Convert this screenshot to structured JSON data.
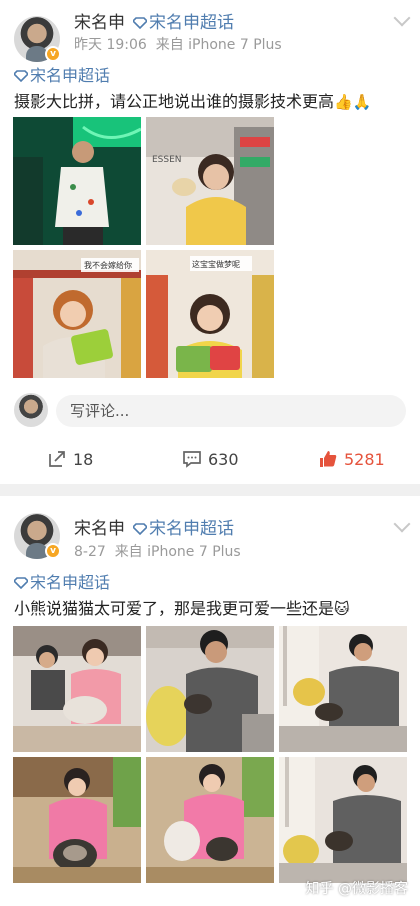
{
  "post1": {
    "username": "宋名申",
    "topic_tag": "宋名申超话",
    "timestamp": "昨天 19:06",
    "source": "来自 iPhone 7 Plus",
    "topic_link": "宋名申超话",
    "text": "摄影大比拼，请公正地说出谁的摄影技术更高",
    "text_emoji": "👍🙏",
    "comment_placeholder": "写评论...",
    "reposts": "18",
    "comments": "630",
    "likes": "5281"
  },
  "post2": {
    "username": "宋名申",
    "topic_tag": "宋名申超话",
    "timestamp": "8-27",
    "source": "来自 iPhone 7 Plus",
    "topic_link": "宋名申超话",
    "text": "小熊说猫猫太可爱了，那是我更可爱一些还是",
    "text_emoji": "🐱"
  },
  "photo1_signs": {
    "store_sign": "ESSEN",
    "sticker_left": "我不会嫁给你",
    "sticker_right": "这宝宝做梦呢"
  },
  "watermark": "知乎 @微影播客",
  "colors": {
    "link": "#507daf",
    "like": "#e5533c",
    "badge": "#f6a623"
  }
}
